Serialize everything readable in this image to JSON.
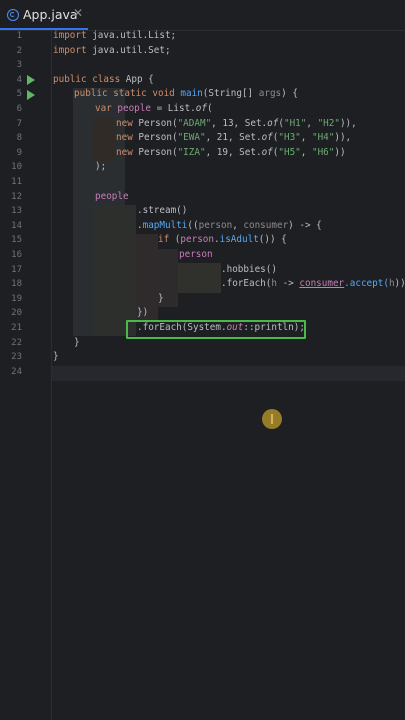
{
  "tab": {
    "label": "App.java",
    "close": "✕"
  },
  "icons": {
    "tab": "java-class-icon",
    "run": "run-arrow-icon",
    "cursor": "text-cursor-icon"
  },
  "colors": {
    "background": "#1e1f22",
    "keyword": "#cf8e6d",
    "string": "#6aab73",
    "function": "#56a8f5",
    "highlight_border": "#4bb84a",
    "run_arrow": "#5fb865"
  },
  "line_numbers": [
    "1",
    "2",
    "3",
    "4",
    "5",
    "6",
    "7",
    "8",
    "9",
    "10",
    "11",
    "12",
    "13",
    "14",
    "15",
    "16",
    "17",
    "18",
    "19",
    "20",
    "21",
    "22",
    "23",
    "24"
  ],
  "code": {
    "l1": {
      "kw": "import",
      "rest": " java.util.List;"
    },
    "l2": {
      "kw": "import",
      "rest": " java.util.Set;"
    },
    "l4": {
      "kw1": "public",
      "kw2": " class",
      "rest": " App {"
    },
    "l5": {
      "kw1": "public",
      "kw2": " static",
      "kw3": " void",
      "fn": " main",
      "p1": "(String[] ",
      "param": "args",
      "p2": ") {"
    },
    "l6": {
      "kw": "var",
      "var": " people",
      "eq": " = List.",
      "fn": "of",
      "p": "("
    },
    "l7": {
      "kw": "new",
      "a": " Person(",
      "s1": "\"ADAM\"",
      "b": ", 13, Set.",
      "of": "of",
      "c": "(",
      "s2": "\"H1\"",
      "d": ", ",
      "s3": "\"H2\"",
      "e": ")),"
    },
    "l8": {
      "kw": "new",
      "a": " Person(",
      "s1": "\"EWA\"",
      "b": ", 21, Set.",
      "of": "of",
      "c": "(",
      "s2": "\"H3\"",
      "d": ", ",
      "s3": "\"H4\"",
      "e": ")),"
    },
    "l9": {
      "kw": "new",
      "a": " Person(",
      "s1": "\"IZA\"",
      "b": ", 19, Set.",
      "of": "of",
      "c": "(",
      "s2": "\"H5\"",
      "d": ", ",
      "s3": "\"H6\"",
      "e": "))"
    },
    "l10": ");",
    "l12": "people",
    "l13": ".stream()",
    "l14": {
      "a": ".",
      "fn": "mapMulti",
      "b": "((",
      "p1": "person",
      "c": ", ",
      "p2": "consumer",
      "d": ") -> {"
    },
    "l15": {
      "kw": "if",
      "a": " (",
      "var": "person",
      "b": ".",
      "fn": "isAdult",
      "c": "()) {"
    },
    "l16": "person",
    "l17": ".hobbies()",
    "l18": {
      "a": ".forEach(",
      "p": "h",
      "b": " -> ",
      "ul": "consumer",
      "c": ".accept(",
      "h": "h",
      "d": "));"
    },
    "l19": "}",
    "l20": "})",
    "l21": {
      "a": ".forEach(System.",
      "fld": "out",
      "b": "::println);"
    },
    "l22": "}",
    "l23": "}"
  }
}
